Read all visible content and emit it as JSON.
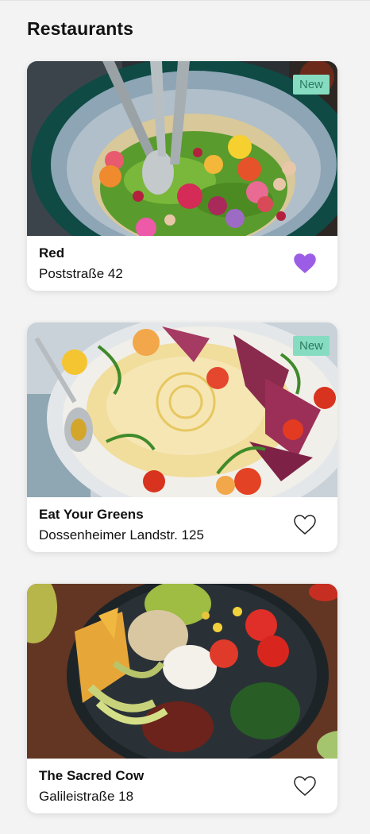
{
  "page": {
    "title": "Restaurants"
  },
  "colors": {
    "favorite_active": "#9b5de5",
    "badge_bg": "#86dcc0",
    "badge_text": "#2b7a61"
  },
  "restaurants": [
    {
      "name": "Red",
      "address": "Poststraße 42",
      "badge": "New",
      "favorite": true,
      "photo": "hummus-bowl-with-herbs-and-flowers"
    },
    {
      "name": "Eat Your Greens",
      "address": "Dossenheimer Landstr. 125",
      "badge": "New",
      "favorite": false,
      "photo": "hummus-plate-with-radicchio-and-tomatoes"
    },
    {
      "name": "The Sacred Cow",
      "address": "Galileistraße 18",
      "badge": "",
      "favorite": false,
      "photo": "buddha-bowl-with-chili-and-guacamole"
    }
  ],
  "icons": {
    "favorite": "heart-icon"
  }
}
